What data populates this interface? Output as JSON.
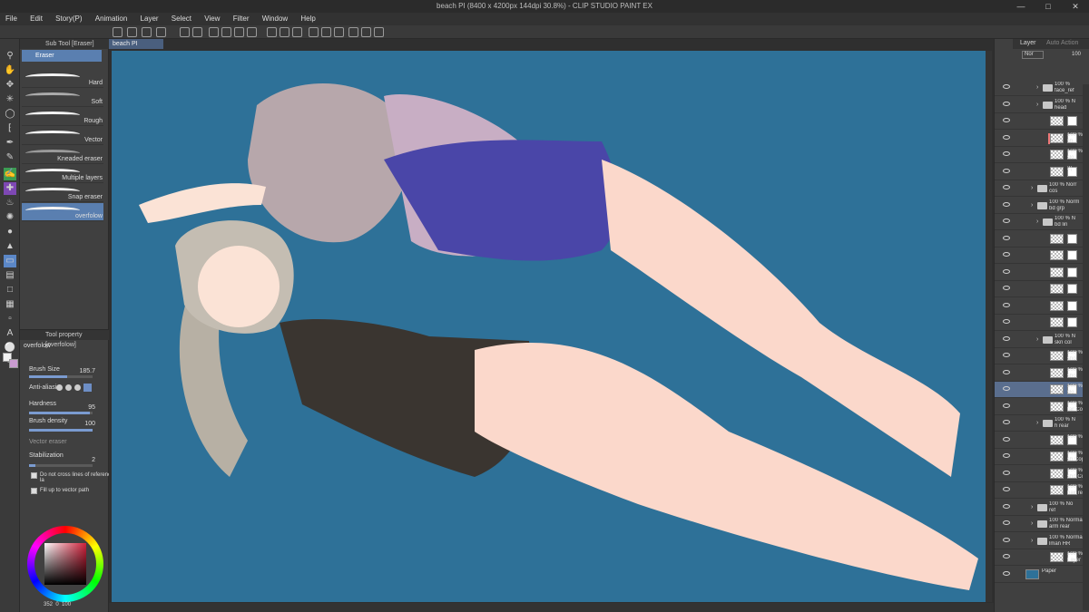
{
  "window": {
    "title": "beach PI (8400 x 4200px 144dpi 30.8%) - CLIP STUDIO PAINT EX"
  },
  "menu": [
    "File",
    "Edit",
    "Story(P)",
    "Animation",
    "Layer",
    "Select",
    "View",
    "Filter",
    "Window",
    "Help"
  ],
  "subtool": {
    "tab": "Sub Tool [Eraser]",
    "group": "Eraser",
    "items": [
      "Hard",
      "Soft",
      "Rough",
      "Vector",
      "Kneaded eraser",
      "Multiple layers",
      "Snap eraser",
      "overfolow"
    ],
    "selected": "overfolow"
  },
  "toolprop": {
    "tab": "Tool property [overfolow]",
    "preset": "overfolow",
    "brush_size_label": "Brush Size",
    "brush_size": "185.7",
    "brush_size_fraction": 0.6,
    "anti_alias_label": "Anti-aliasin",
    "hardness_label": "Hardness",
    "hardness": "95",
    "hardness_fraction": 0.95,
    "density_label": "Brush density",
    "density": "100",
    "density_fraction": 1.0,
    "vector_eraser_label": "Vector eraser",
    "stabilization_label": "Stabilization",
    "stabilization": "2",
    "stabilization_fraction": 0.1,
    "no_cross_label": "Do not cross lines of reference la",
    "fill_vector_label": "Fill up to vector path"
  },
  "color": {
    "main": "#f2f2f2",
    "sub": "#c99bd0",
    "accent": "#5a7fb0",
    "canvas_bg": "#2e7198",
    "readout": [
      "352",
      "0",
      "100"
    ]
  },
  "document": {
    "tab": "beach PI"
  },
  "layers": {
    "tabs": [
      "Layer",
      "Auto Action"
    ],
    "blend_mode": "Nor",
    "opacity": "100",
    "rows": [
      {
        "line1": "100 %",
        "line2": "face_ref",
        "kind": "folder",
        "indent": 1
      },
      {
        "line1": "100 % N",
        "line2": "head",
        "kind": "folder",
        "indent": 1
      },
      {
        "line1": "",
        "line2": "",
        "kind": "layer",
        "indent": 2
      },
      {
        "line1": "100 % !",
        "line2": "sh",
        "kind": "layer",
        "indent": 2
      },
      {
        "line1": "100 %",
        "line2": "ski",
        "kind": "layer",
        "indent": 2
      },
      {
        "line1": "2(",
        "line2": "",
        "kind": "image",
        "indent": 2
      },
      {
        "line1": "100 % Norr",
        "line2": "cos",
        "kind": "folder",
        "indent": 0
      },
      {
        "line1": "100 % Norm",
        "line2": "bd grp",
        "kind": "folder",
        "indent": 0
      },
      {
        "line1": "100 % N",
        "line2": "bd lin",
        "kind": "folder",
        "indent": 1
      },
      {
        "line1": "",
        "line2": "",
        "kind": "layer",
        "indent": 2
      },
      {
        "line1": "",
        "line2": "",
        "kind": "layer",
        "indent": 2
      },
      {
        "line1": "",
        "line2": "",
        "kind": "layer",
        "indent": 2
      },
      {
        "line1": "",
        "line2": "",
        "kind": "layer",
        "indent": 2
      },
      {
        "line1": "",
        "line2": "",
        "kind": "layer",
        "indent": 2
      },
      {
        "line1": "",
        "line2": "",
        "kind": "layer",
        "indent": 2
      },
      {
        "line1": "100 % N",
        "line2": "skn col",
        "kind": "folder",
        "indent": 1
      },
      {
        "line1": "100 %",
        "line2": "sho",
        "kind": "layer",
        "indent": 2
      },
      {
        "line1": "100 %",
        "line2": "sho",
        "kind": "layer",
        "indent": 2
      },
      {
        "line1": "100 %",
        "line2": "ski",
        "kind": "layer",
        "indent": 2
      },
      {
        "line1": "100 % Norm",
        "line2": "tail Copy",
        "kind": "layer",
        "indent": 0
      },
      {
        "line1": "100 % N",
        "line2": "h rear",
        "kind": "folder",
        "indent": 1
      },
      {
        "line1": "100 % 1",
        "line2": "",
        "kind": "layer",
        "indent": 2
      },
      {
        "line1": "100 % 1",
        "line2": "sh Copy",
        "kind": "layer",
        "indent": 2
      },
      {
        "line1": "100 % 1",
        "line2": "shd Cop",
        "kind": "layer",
        "indent": 2
      },
      {
        "line1": "100 % 1",
        "line2": "hair rea",
        "kind": "layer",
        "indent": 2
      },
      {
        "line1": "100 % No",
        "line2": "ref",
        "kind": "folder",
        "indent": 0
      },
      {
        "line1": "100 % Normal",
        "line2": "arm rear",
        "kind": "folder",
        "indent": 0
      },
      {
        "line1": "100 % Normal",
        "line2": "lman HR",
        "kind": "folder",
        "indent": 0
      },
      {
        "line1": "100 % Normal",
        "line2": "Layer 1",
        "kind": "layer",
        "indent": 0
      },
      {
        "line1": "Paper",
        "line2": "",
        "kind": "paper",
        "indent": 0
      }
    ]
  }
}
